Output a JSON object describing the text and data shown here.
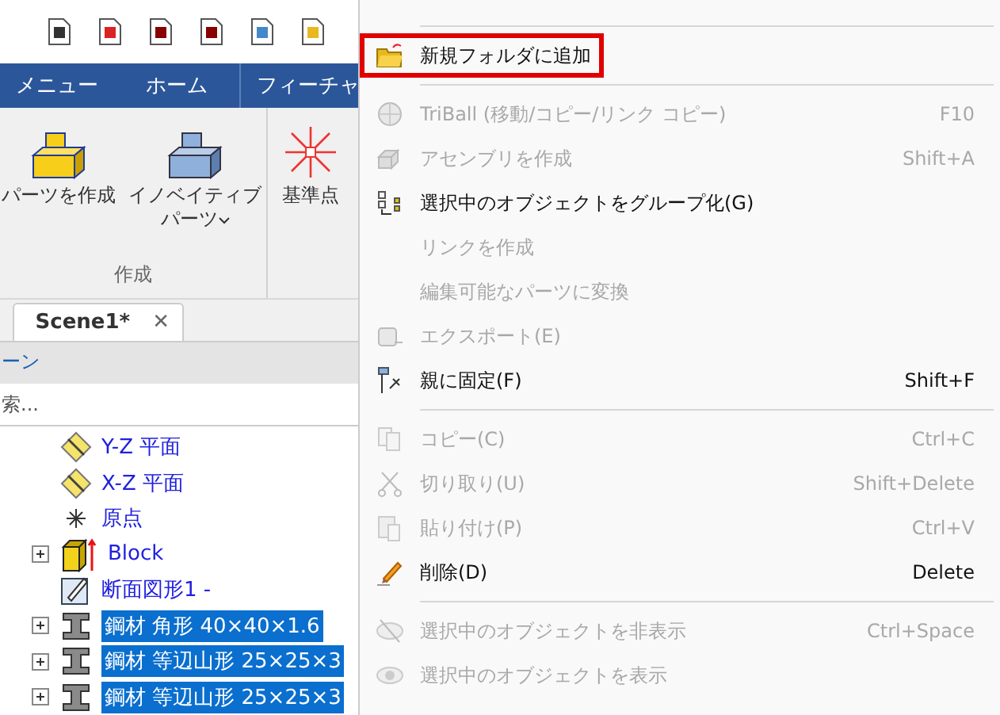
{
  "ribbon": {
    "tabs": [
      {
        "label": "メニュー",
        "selected": false
      },
      {
        "label": "ホーム",
        "selected": false
      },
      {
        "label": "フィーチャ",
        "selected": false
      }
    ],
    "buttons": [
      {
        "label": "パーツを作成",
        "kind": "part",
        "dropdown": false
      },
      {
        "label": "イノベイティブパーツ",
        "kind": "innovative",
        "dropdown": true
      },
      {
        "label": "基準点",
        "kind": "point",
        "dropdown": false
      }
    ],
    "group_label": "作成"
  },
  "scene_tab": {
    "label": "Scene1*",
    "close": "✕"
  },
  "scene_bar": {
    "label": "ーン"
  },
  "search": {
    "placeholder": "索..."
  },
  "tree": [
    {
      "label": "Y-Z 平面",
      "kind": "plane",
      "expandable": false,
      "selected": false
    },
    {
      "label": "X-Z 平面",
      "kind": "plane",
      "expandable": false,
      "selected": false
    },
    {
      "label": "原点",
      "kind": "origin",
      "expandable": false,
      "selected": false
    },
    {
      "label": "Block",
      "kind": "block",
      "expandable": true,
      "selected": false
    },
    {
      "label": "断面図形1 -",
      "kind": "sketch",
      "expandable": false,
      "selected": false
    },
    {
      "label": "鋼材 角形 40×40×1.6",
      "kind": "beam",
      "expandable": true,
      "selected": true
    },
    {
      "label": "鋼材 等辺山形 25×25×3",
      "kind": "beam",
      "expandable": true,
      "selected": true
    },
    {
      "label": "鋼材 等辺山形 25×25×3",
      "kind": "beam",
      "expandable": true,
      "selected": true
    }
  ],
  "menu": [
    {
      "kind": "separator"
    },
    {
      "kind": "folder",
      "label": "新規フォルダに追加",
      "disabled": false,
      "highlighted": true
    },
    {
      "kind": "separator"
    },
    {
      "kind": "ball",
      "label": "TriBall (移動/コピー/リンク コピー)",
      "shortcut": "F10",
      "disabled": true,
      "highlighted": false
    },
    {
      "kind": "assembly",
      "label": "アセンブリを作成",
      "shortcut": "Shift+A",
      "disabled": true,
      "highlighted": false
    },
    {
      "kind": "group",
      "label": "選択中のオブジェクトをグループ化(G)",
      "disabled": false,
      "highlighted": false
    },
    {
      "kind": "plain",
      "label": "リンクを作成",
      "disabled": true,
      "highlighted": false
    },
    {
      "kind": "plain",
      "label": "編集可能なパーツに変換",
      "disabled": true,
      "highlighted": false
    },
    {
      "kind": "export",
      "label": "エクスポート(E)",
      "disabled": true,
      "highlighted": false
    },
    {
      "kind": "pin",
      "label": "親に固定(F)",
      "shortcut": "Shift+F",
      "disabled": false,
      "highlighted": false
    },
    {
      "kind": "separator"
    },
    {
      "kind": "copy",
      "label": "コピー(C)",
      "shortcut": "Ctrl+C",
      "disabled": true,
      "highlighted": false
    },
    {
      "kind": "cut",
      "label": "切り取り(U)",
      "shortcut": "Shift+Delete",
      "disabled": true,
      "highlighted": false
    },
    {
      "kind": "paste",
      "label": "貼り付け(P)",
      "shortcut": "Ctrl+V",
      "disabled": true,
      "highlighted": false
    },
    {
      "kind": "eraser",
      "label": "削除(D)",
      "shortcut": "Delete",
      "disabled": false,
      "highlighted": false
    },
    {
      "kind": "separator"
    },
    {
      "kind": "hide",
      "label": "選択中のオブジェクトを非表示",
      "shortcut": "Ctrl+Space",
      "disabled": true,
      "highlighted": false
    },
    {
      "kind": "show",
      "label": "選択中のオブジェクトを表示",
      "disabled": true,
      "highlighted": false
    }
  ]
}
